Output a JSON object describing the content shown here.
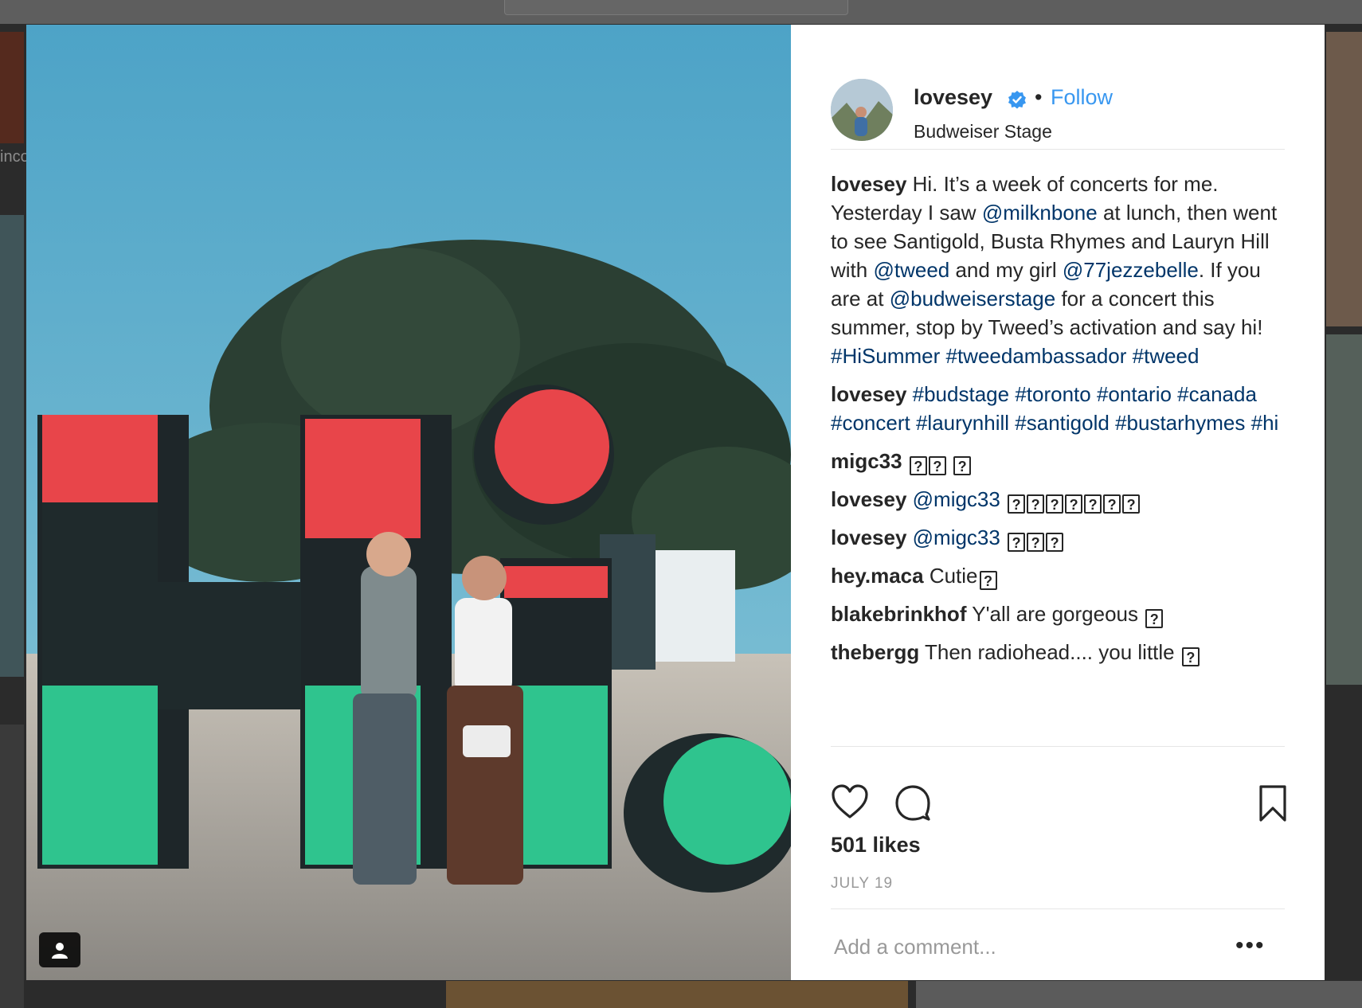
{
  "post": {
    "username": "lovesey",
    "follow_label": "Follow",
    "separator": "•",
    "location": "Budweiser Stage"
  },
  "comments": [
    {
      "user": "lovesey",
      "parts": [
        {
          "t": " Hi. It’s a week of concerts for me. Yesterday I saw "
        },
        {
          "t": "@milknbone",
          "link": true
        },
        {
          "t": " at lunch, then went to see Santigold, Busta Rhymes and Lauryn Hill with "
        },
        {
          "t": "@tweed",
          "link": true
        },
        {
          "t": " and my girl "
        },
        {
          "t": "@77jezzebelle",
          "link": true
        },
        {
          "t": ". If you are at "
        },
        {
          "t": "@budweiserstage",
          "link": true
        },
        {
          "t": " for a concert this summer, stop by Tweed’s activation and say hi! "
        },
        {
          "t": "#HiSummer",
          "link": true
        },
        {
          "t": " "
        },
        {
          "t": "#tweedambassador",
          "link": true
        },
        {
          "t": " "
        },
        {
          "t": "#tweed",
          "link": true
        }
      ]
    },
    {
      "user": "lovesey",
      "parts": [
        {
          "t": " "
        },
        {
          "t": "#budstage",
          "link": true
        },
        {
          "t": " "
        },
        {
          "t": "#toronto",
          "link": true
        },
        {
          "t": " "
        },
        {
          "t": "#ontario",
          "link": true
        },
        {
          "t": " "
        },
        {
          "t": "#canada",
          "link": true
        },
        {
          "t": " "
        },
        {
          "t": "#concert",
          "link": true
        },
        {
          "t": " "
        },
        {
          "t": "#laurynhill",
          "link": true
        },
        {
          "t": " "
        },
        {
          "t": "#santigold",
          "link": true
        },
        {
          "t": " "
        },
        {
          "t": "#bustarhymes",
          "link": true
        },
        {
          "t": " "
        },
        {
          "t": "#hi",
          "link": true
        }
      ]
    },
    {
      "user": "migc33",
      "parts": [
        {
          "t": " "
        },
        {
          "t": "?",
          "rep": true
        },
        {
          "t": "?",
          "rep": true
        },
        {
          "t": " "
        },
        {
          "t": "?",
          "rep": true
        }
      ]
    },
    {
      "user": "lovesey",
      "parts": [
        {
          "t": " "
        },
        {
          "t": "@migc33",
          "link": true
        },
        {
          "t": " "
        },
        {
          "t": "?",
          "rep": true
        },
        {
          "t": "?",
          "rep": true
        },
        {
          "t": "?",
          "rep": true
        },
        {
          "t": "?",
          "rep": true
        },
        {
          "t": "?",
          "rep": true
        },
        {
          "t": "?",
          "rep": true
        },
        {
          "t": "?",
          "rep": true
        }
      ]
    },
    {
      "user": "lovesey",
      "parts": [
        {
          "t": " "
        },
        {
          "t": "@migc33",
          "link": true
        },
        {
          "t": " "
        },
        {
          "t": "?",
          "rep": true
        },
        {
          "t": "?",
          "rep": true
        },
        {
          "t": "?",
          "rep": true
        }
      ]
    },
    {
      "user": "hey.maca",
      "parts": [
        {
          "t": " Cutie"
        },
        {
          "t": "?",
          "rep": true
        }
      ]
    },
    {
      "user": "blakebrinkhof",
      "parts": [
        {
          "t": " Y'all are gorgeous "
        },
        {
          "t": "?",
          "rep": true
        }
      ]
    },
    {
      "user": "thebergg",
      "parts": [
        {
          "t": " Then radiohead.... you little "
        },
        {
          "t": "?",
          "rep": true
        }
      ]
    }
  ],
  "likes": "501 likes",
  "date": "JULY 19",
  "add_comment_placeholder": "Add a comment...",
  "more_label": "•••",
  "background": {
    "partial_text": "inco"
  },
  "icons": [
    "heart-icon",
    "comment-icon",
    "bookmark-icon",
    "verified-badge-icon",
    "user-tag-icon"
  ],
  "colors": {
    "accent": "#3897f0",
    "link": "#003569",
    "text": "#262626",
    "muted": "#999999"
  }
}
